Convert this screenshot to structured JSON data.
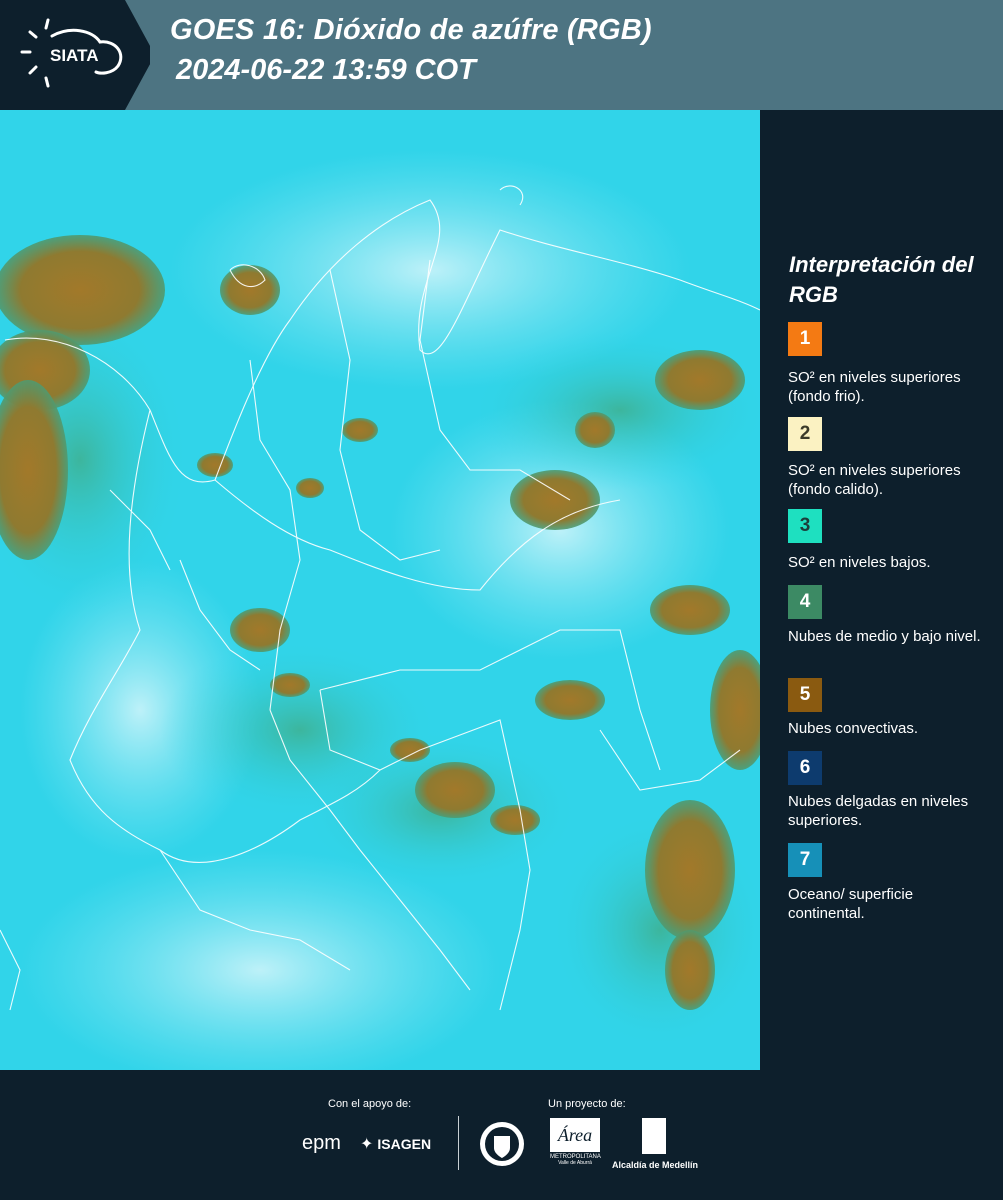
{
  "header": {
    "logo_text": "SIATA",
    "title_line1": "GOES 16: Dióxido de azúfre (RGB)",
    "title_line2": "2024-06-22 13:59 COT"
  },
  "map": {
    "icon": "satellite-map-image"
  },
  "legend": {
    "title": "Interpretación del RGB",
    "items": [
      {
        "number": "1",
        "color": "#f47a13",
        "text_color": "#ffffff",
        "description": "SO² en niveles superiores (fondo frio)."
      },
      {
        "number": "2",
        "color": "#fbf2c2",
        "text_color": "#3b3b2a",
        "description": "SO² en niveles superiores (fondo calido)."
      },
      {
        "number": "3",
        "color": "#1ee0c0",
        "text_color": "#1c3d3a",
        "description": "SO² en niveles bajos."
      },
      {
        "number": "4",
        "color": "#3c8a64",
        "text_color": "#ffffff",
        "description": "Nubes de medio y bajo nivel."
      },
      {
        "number": "5",
        "color": "#8a5a10",
        "text_color": "#ffffff",
        "description": "Nubes convectivas."
      },
      {
        "number": "6",
        "color": "#0d3b6e",
        "text_color": "#ffffff",
        "description": "Nubes delgadas en niveles superiores."
      },
      {
        "number": "7",
        "color": "#1690b8",
        "text_color": "#ffffff",
        "description": "Oceano/ superficie continental."
      }
    ]
  },
  "footer": {
    "support_label": "Con el apoyo de:",
    "project_label": "Un proyecto de:",
    "sponsor_1": "epm",
    "sponsor_2": "ISAGEN",
    "partner_1_icon": "medellin-seal-icon",
    "partner_2": "METROPOLITANA",
    "partner_2_sub": "Valle de Aburrá",
    "partner_3": "Alcaldía de Medellín"
  },
  "colors": {
    "header_bg": "#4d7482",
    "panel_bg": "#0d1f2c",
    "map_base": "#2fd6ea",
    "cloud_brown": "#9a7a2a"
  }
}
